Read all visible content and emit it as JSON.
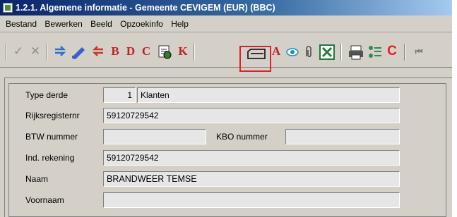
{
  "window": {
    "title": "1.2.1. Algemene informatie - Gemeente CEVIGEM (EUR) (BBC)"
  },
  "menu": [
    "Bestand",
    "Bewerken",
    "Beeld",
    "Opzoekinfo",
    "Help"
  ],
  "toolbar": {
    "buttons": {
      "check": "✓",
      "cross": "✕",
      "b": "B",
      "d": "D",
      "c": "C",
      "k": "K",
      "a": "A",
      "c_red": "C",
      "first": "⏮"
    }
  },
  "form": {
    "type_derde": {
      "label": "Type derde",
      "code": "1",
      "value": "Klanten"
    },
    "rijksregister": {
      "label": "Rijksregisternr",
      "value": "59120729542"
    },
    "btw": {
      "label": "BTW nummer",
      "value": ""
    },
    "kbo": {
      "label": "KBO nummer",
      "value": ""
    },
    "ind_rekening": {
      "label": "Ind. rekening",
      "value": "59120729542"
    },
    "naam": {
      "label": "Naam",
      "value": "BRANDWEER TEMSE"
    },
    "voornaam": {
      "label": "Voornaam",
      "value": ""
    }
  }
}
